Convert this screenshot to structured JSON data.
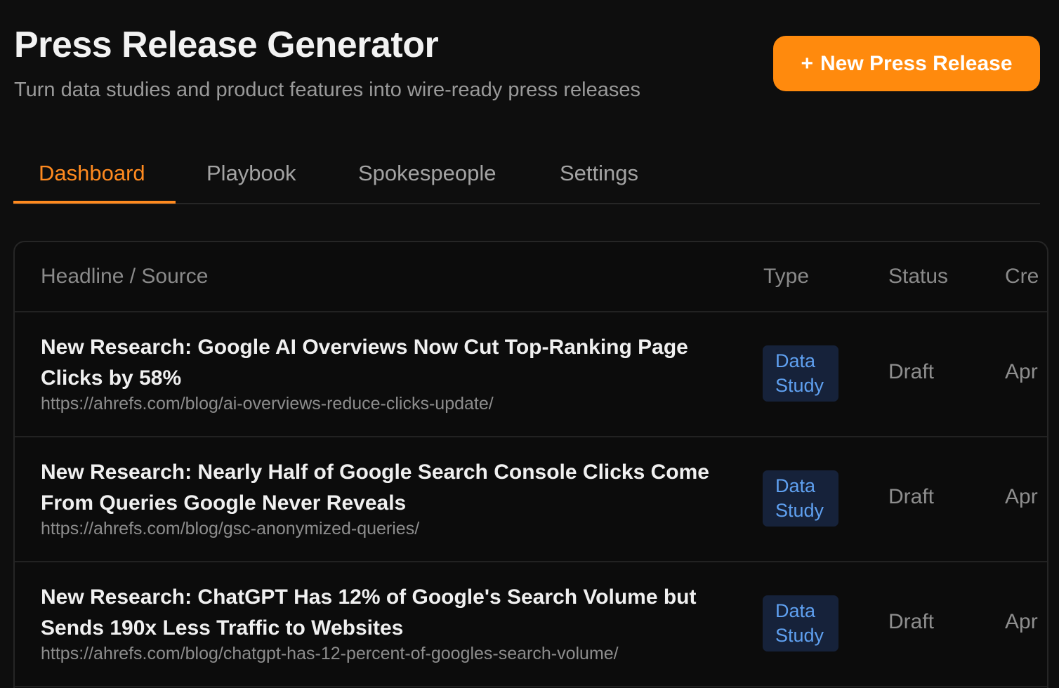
{
  "header": {
    "title": "Press Release Generator",
    "subtitle": "Turn data studies and product features into wire-ready press releases",
    "new_button_icon": "+",
    "new_button_label": "New Press Release"
  },
  "tabs": [
    {
      "label": "Dashboard",
      "active": true
    },
    {
      "label": "Playbook",
      "active": false
    },
    {
      "label": "Spokespeople",
      "active": false
    },
    {
      "label": "Settings",
      "active": false
    }
  ],
  "table": {
    "columns": [
      "Headline / Source",
      "Type",
      "Status",
      "Cre"
    ],
    "rows": [
      {
        "headline": "New Research: Google AI Overviews Now Cut Top-Ranking Page Clicks by 58%",
        "url": "https://ahrefs.com/blog/ai-overviews-reduce-clicks-update/",
        "type": "Data Study",
        "status": "Draft",
        "created": "Apr"
      },
      {
        "headline": "New Research: Nearly Half of Google Search Console Clicks Come From Queries Google Never Reveals",
        "url": "https://ahrefs.com/blog/gsc-anonymized-queries/",
        "type": "Data Study",
        "status": "Draft",
        "created": "Apr"
      },
      {
        "headline": "New Research: ChatGPT Has 12% of Google's Search Volume but Sends 190x Less Traffic to Websites",
        "url": "https://ahrefs.com/blog/chatgpt-has-12-percent-of-googles-search-volume/",
        "type": "Data Study",
        "status": "Draft",
        "created": "Apr"
      }
    ]
  },
  "colors": {
    "background": "#0e0e0e",
    "accent": "#ff8a0d",
    "badge_bg": "#16223a",
    "badge_text": "#5fa0f0"
  }
}
